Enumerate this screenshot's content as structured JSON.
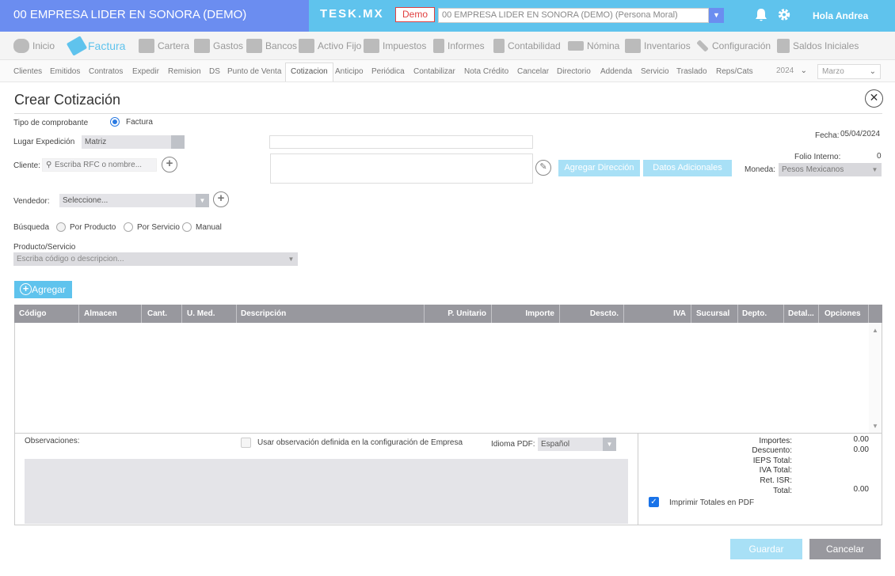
{
  "topbar": {
    "company": "00 EMPRESA LIDER EN SONORA (DEMO)",
    "brand": "TESK.MX",
    "demo": "Demo",
    "company_select": "00 EMPRESA LIDER EN SONORA (DEMO) (Persona Moral)",
    "greeting": "Hola Andrea"
  },
  "mainnav": [
    "Inicio",
    "Factura",
    "Cartera",
    "Gastos",
    "Bancos",
    "Activo Fijo",
    "Impuestos",
    "Informes",
    "Contabilidad",
    "Nómina",
    "Inventarios",
    "Configuración",
    "Saldos Iniciales"
  ],
  "subnav": [
    "Clientes",
    "Emitidos",
    "Contratos",
    "Expedir",
    "Remision",
    "DS",
    "Punto de Venta",
    "Cotizacion",
    "Anticipo",
    "Periódica",
    "Contabilizar",
    "Nota Crédito",
    "Cancelar",
    "Directorio",
    "Addenda",
    "Servicio",
    "Traslado",
    "Reps/Cats"
  ],
  "year": "2024",
  "month": "Marzo",
  "form": {
    "title": "Crear Cotización",
    "tipo_label": "Tipo de comprobante",
    "tipo_value": "Factura",
    "lugar_label": "Lugar Expedición",
    "lugar_value": "Matriz",
    "cliente_label": "Cliente:",
    "cliente_placeholder": "Escriba RFC o nombre...",
    "agregar_direccion": "Agregar Dirección",
    "datos_adicionales": "Datos Adicionales",
    "fecha_label": "Fecha:",
    "fecha_value": "05/04/2024",
    "folio_label": "Folio Interno:",
    "folio_value": "0",
    "moneda_label": "Moneda:",
    "moneda_value": "Pesos Mexicanos",
    "vendedor_label": "Vendedor:",
    "vendedor_value": "Seleccione...",
    "busqueda_label": "Búsqueda",
    "busqueda_options": [
      "Por Producto",
      "Por Servicio",
      "Manual"
    ],
    "producto_label": "Producto/Servicio",
    "producto_placeholder": "Escriba código o descripcion...",
    "agregar": "Agregar"
  },
  "table": {
    "columns": [
      "Código",
      "Almacen",
      "Cant.",
      "U. Med.",
      "Descripción",
      "P. Unitario",
      "Importe",
      "Descto.",
      "IVA",
      "Sucursal",
      "Depto.",
      "Detal...",
      "Opciones"
    ]
  },
  "bottom": {
    "observaciones": "Observaciones:",
    "usar_obs": "Usar observación definida en la configuración de Empresa",
    "idioma_label": "Idioma PDF:",
    "idioma_value": "Español",
    "totals": [
      {
        "label": "Importes:",
        "value": "0.00"
      },
      {
        "label": "Descuento:",
        "value": "0.00"
      },
      {
        "label": "IEPS Total:",
        "value": ""
      },
      {
        "label": "IVA Total:",
        "value": ""
      },
      {
        "label": "Ret. ISR:",
        "value": ""
      },
      {
        "label": "Total:",
        "value": "0.00"
      }
    ],
    "imprimir": "Imprimir Totales en PDF"
  },
  "buttons": {
    "guardar": "Guardar",
    "cancelar": "Cancelar"
  },
  "colors": {
    "accent": "#5fc3ed",
    "header_left": "#6b8df0",
    "table_header": "#98989e",
    "cancel": "#98989e"
  }
}
